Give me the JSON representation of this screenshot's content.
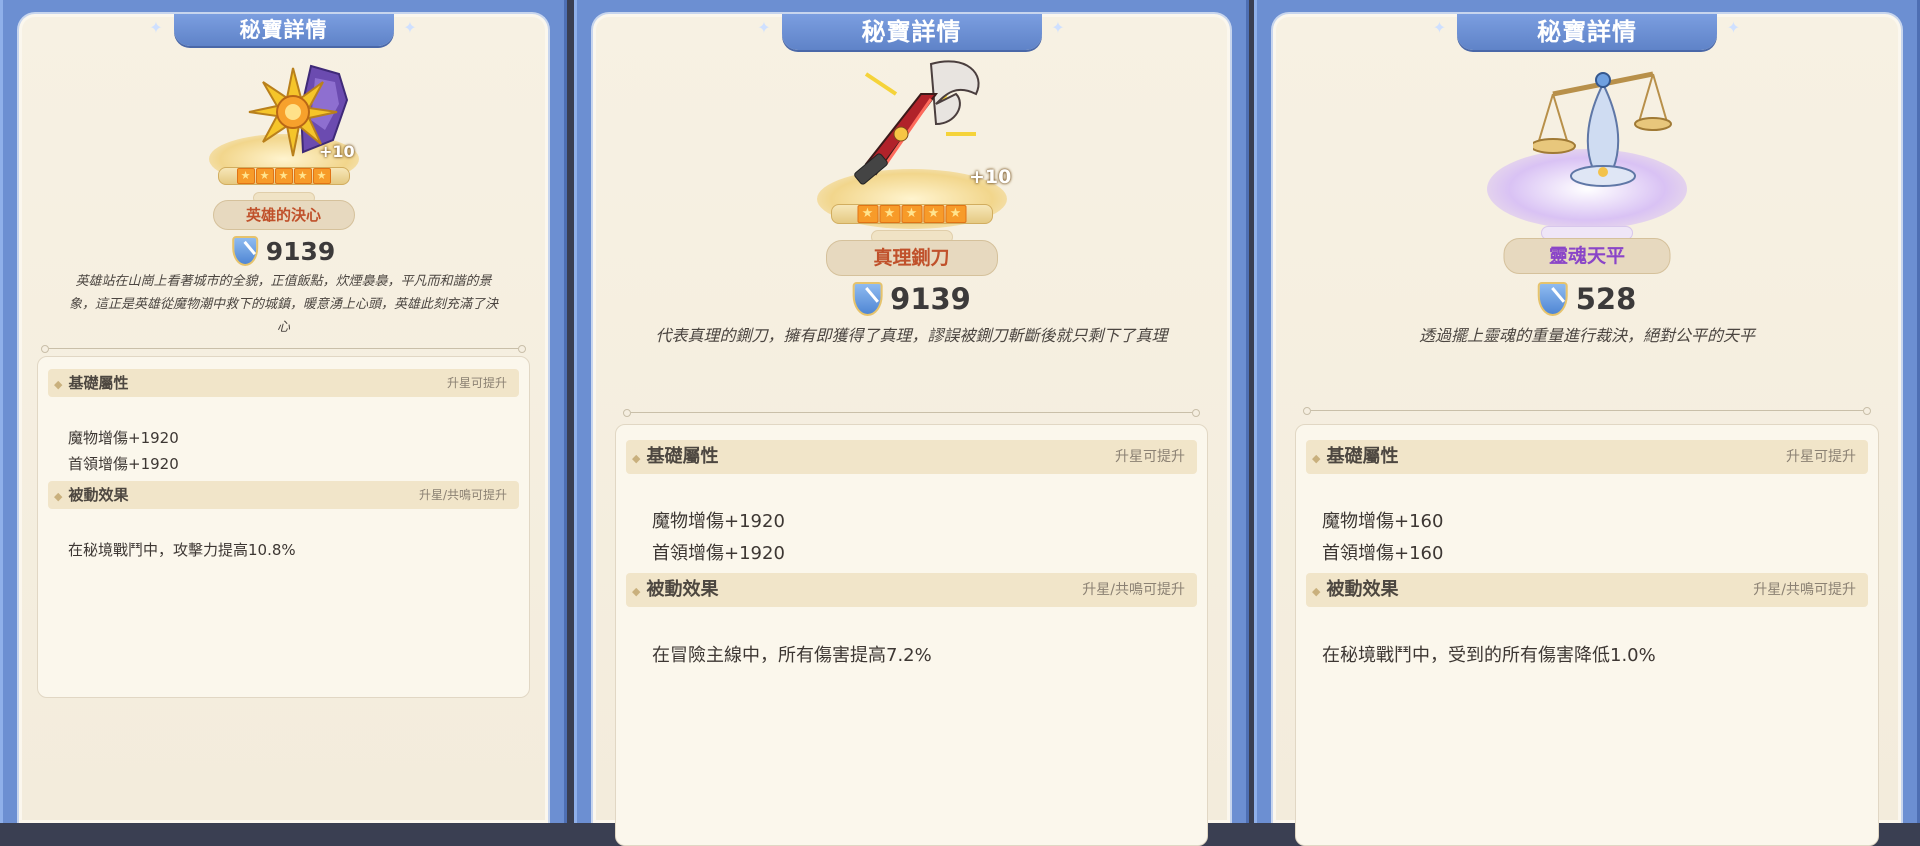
{
  "panels": [
    {
      "title": "秘寶詳情",
      "plus": "+10",
      "name": "英雄的決心",
      "score": "9139",
      "description": "英雄站在山崗上看著城市的全貌，正值飯點，炊煙裊裊，平凡而和諧的景象，這正是英雄從魔物潮中救下的城鎮，暖意湧上心頭，英雄此刻充滿了決心",
      "basic_header": "基礎屬性",
      "basic_hint": "升星可提升",
      "basic_lines": [
        "魔物增傷+1920",
        "首領增傷+1920"
      ],
      "passive_header": "被動效果",
      "passive_hint": "升星/共鳴可提升",
      "passive_lines": [
        "在秘境戰鬥中，攻擊力提高10.8%"
      ],
      "icon": "golden-sun-crystal-icon"
    },
    {
      "title": "秘寶詳情",
      "plus": "+10",
      "name": "真理鍘刀",
      "score": "9139",
      "description": "代表真理的鍘刀，擁有即獲得了真理，謬誤被鍘刀斬斷後就只剩下了真理",
      "basic_header": "基礎屬性",
      "basic_hint": "升星可提升",
      "basic_lines": [
        "魔物增傷+1920",
        "首領增傷+1920"
      ],
      "passive_header": "被動效果",
      "passive_hint": "升星/共鳴可提升",
      "passive_lines": [
        "在冒險主線中，所有傷害提高7.2%"
      ],
      "icon": "red-guillotine-blade-icon"
    },
    {
      "title": "秘寶詳情",
      "name": "靈魂天平",
      "score": "528",
      "description": "透過擺上靈魂的重量進行裁決，絕對公平的天平",
      "basic_header": "基礎屬性",
      "basic_hint": "升星可提升",
      "basic_lines": [
        "魔物增傷+160",
        "首領增傷+160"
      ],
      "passive_header": "被動效果",
      "passive_hint": "升星/共鳴可提升",
      "passive_lines": [
        "在秘境戰鬥中，受到的所有傷害降低1.0%"
      ],
      "icon": "soul-scale-icon"
    }
  ],
  "colors": {
    "frame": "#6c8fd2",
    "paper": "#f5eee0",
    "stars": "#f79b29",
    "rare_name": "#c0512b",
    "epic_name": "#8a45c8"
  }
}
